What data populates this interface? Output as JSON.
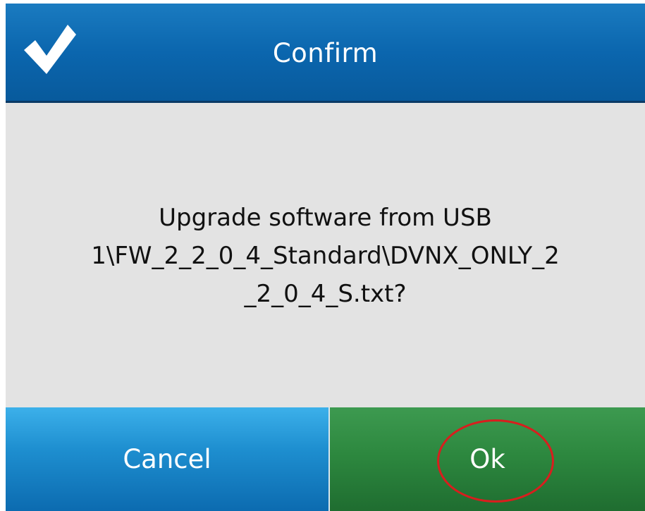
{
  "dialog": {
    "title": "Confirm",
    "icon": "checkmark-icon",
    "message_lines": [
      "Upgrade software from USB",
      "1\\FW_2_2_0_4_Standard\\DVNX_ONLY_2",
      "_2_0_4_S.txt?"
    ],
    "buttons": {
      "cancel_label": "Cancel",
      "ok_label": "Ok"
    }
  },
  "colors": {
    "title_bar": "#0b66ae",
    "content_bg": "#e3e3e3",
    "cancel_button": "#1e8fd0",
    "ok_button": "#2d883f",
    "annotation": "#d81e1e"
  }
}
